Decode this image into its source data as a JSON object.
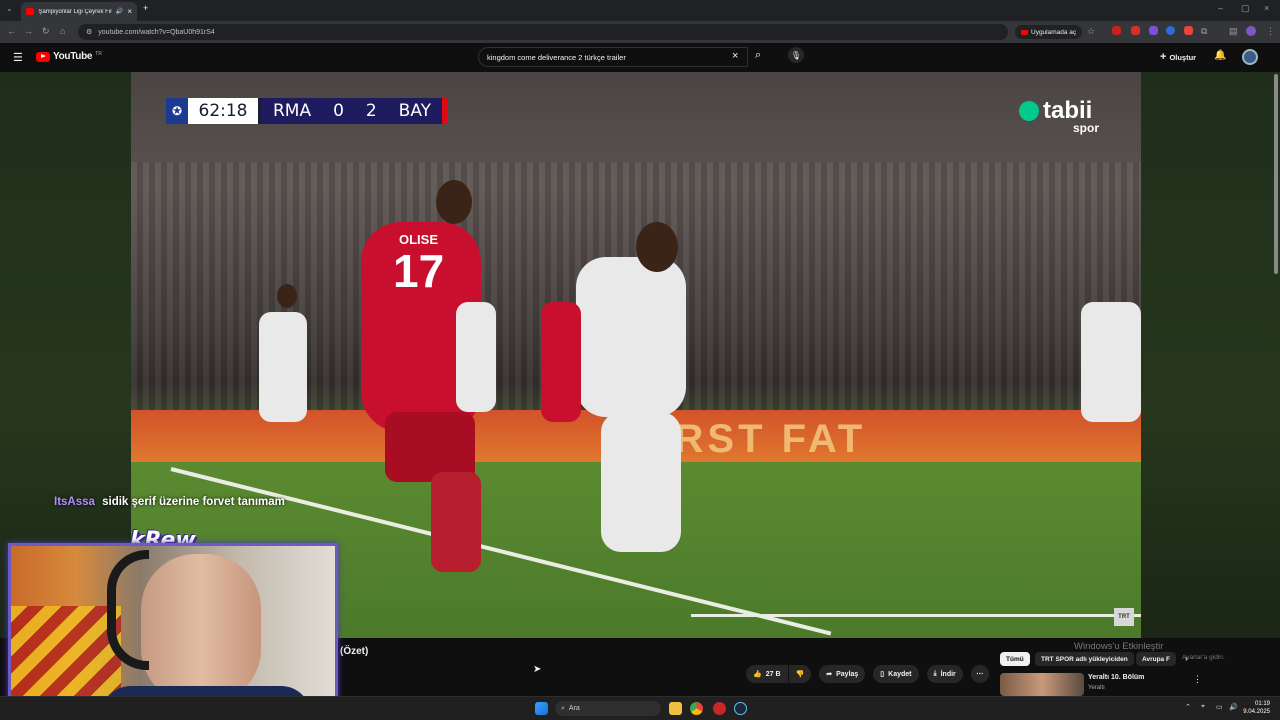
{
  "browser": {
    "tab_title": "Şampiyonlar Ligi Çeyrek Fin",
    "url": "youtube.com/watch?v=QbaU0h91rS4",
    "open_in_app": "Uygulamada aç"
  },
  "youtube": {
    "logo_text": "YouTube",
    "region": "TR",
    "search_query": "kingdom come deliverance 2 türkçe trailer",
    "create_label": "Oluştur"
  },
  "video": {
    "scorebug": {
      "time": "62:18",
      "home": "RMA",
      "home_score": "0",
      "away_score": "2",
      "away": "BAY"
    },
    "broadcaster": "tabii",
    "broadcaster_sub": "spor",
    "jersey_number": "17",
    "jersey_name": "OLISE",
    "ad_board_text": "FIRST FAT",
    "corner_logo": "TRT"
  },
  "chat": {
    "user": "ItsAssa",
    "message": "sidik şerif üzerine forvet tanımam"
  },
  "streamer": {
    "name": "kRew"
  },
  "below_video": {
    "title_fragment": "(Özet)",
    "likes": "27 B",
    "share": "Paylaş",
    "save": "Kaydet",
    "download": "İndir"
  },
  "recommendations": {
    "chips": [
      "Tümü",
      "TRT SPOR adlı yükleyiciden",
      "Avrupa F"
    ],
    "item_title": "Yeraltı 10. Bölüm",
    "item_channel": "Yeraltı"
  },
  "windows": {
    "activate_title": "Windows'u Etkinleştir",
    "activate_sub": "Ayarlar'a gidin."
  },
  "taskbar": {
    "search_placeholder": "Ara",
    "time": "01:19",
    "date": "9.04.2025"
  }
}
